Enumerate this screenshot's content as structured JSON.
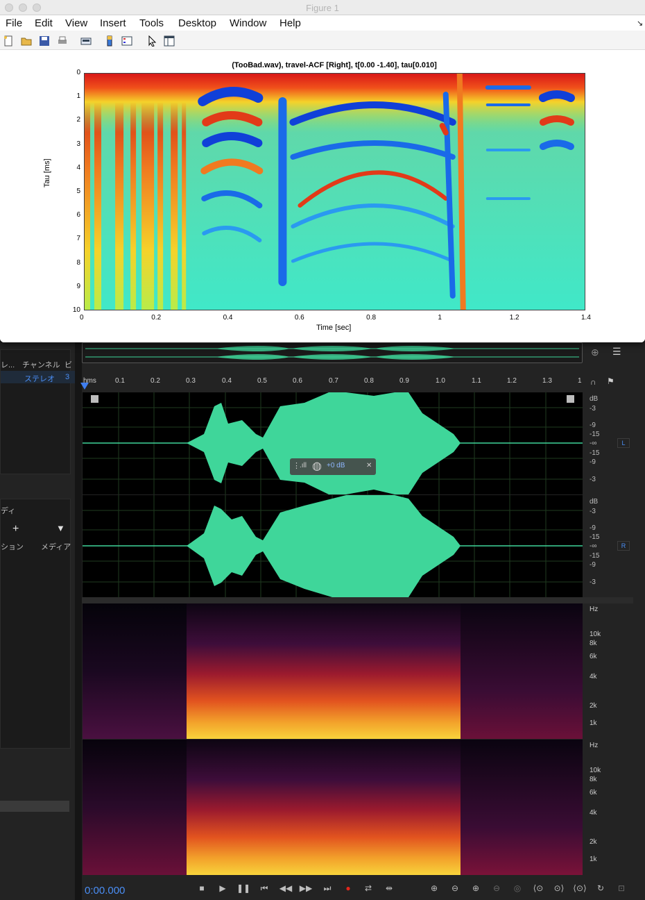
{
  "figure": {
    "window_title": "Figure 1",
    "menu": [
      "File",
      "Edit",
      "View",
      "Insert",
      "Tools",
      "Desktop",
      "Window",
      "Help"
    ],
    "toolbar_icons": [
      "new-figure-icon",
      "open-file-icon",
      "save-icon",
      "print-icon",
      "link-icon",
      "colorbar-icon",
      "legend-icon",
      "pointer-icon",
      "panel-icon"
    ]
  },
  "chart_data": {
    "type": "heatmap",
    "title": "(TooBad.wav), travel-ACF [Right], t[0.00 -1.40], tau[0.010]",
    "xlabel": "Time [sec]",
    "ylabel": "Tau [ms]",
    "xlim": [
      0,
      1.4
    ],
    "ylim": [
      0,
      10
    ],
    "y_reversed": true,
    "x_ticks": [
      "0",
      "0.2",
      "0.4",
      "0.6",
      "0.8",
      "1",
      "1.2",
      "1.4"
    ],
    "y_ticks": [
      "0",
      "1",
      "2",
      "3",
      "4",
      "5",
      "6",
      "7",
      "8",
      "9",
      "10"
    ],
    "colormap": "jet"
  },
  "editor": {
    "panel_headers": [
      "レ...",
      "チャンネル",
      "ビ"
    ],
    "channel_value": "ステレオ",
    "channel_extra": "3",
    "panel_label_di": "ディ",
    "panel_btn1": "ション",
    "panel_btn2": "メディア",
    "ruler_ticks": [
      "hms",
      "0.1",
      "0.2",
      "0.3",
      "0.4",
      "0.5",
      "0.6",
      "0.7",
      "0.8",
      "0.9",
      "1.0",
      "1.1",
      "1.2",
      "1.3",
      "1"
    ],
    "db_labels": [
      "dB",
      "-3",
      "-9",
      "-15",
      "-∞",
      "-15",
      "-9",
      "-3"
    ],
    "hz_labels": [
      "Hz",
      "10k",
      "8k",
      "6k",
      "4k",
      "2k",
      "1k"
    ],
    "channel_left": "L",
    "channel_right": "R",
    "hud_gain": "+0 dB",
    "timecode": "0:00.000",
    "waveform_color": "#3fd69a",
    "accent": "#4a8ef5"
  }
}
